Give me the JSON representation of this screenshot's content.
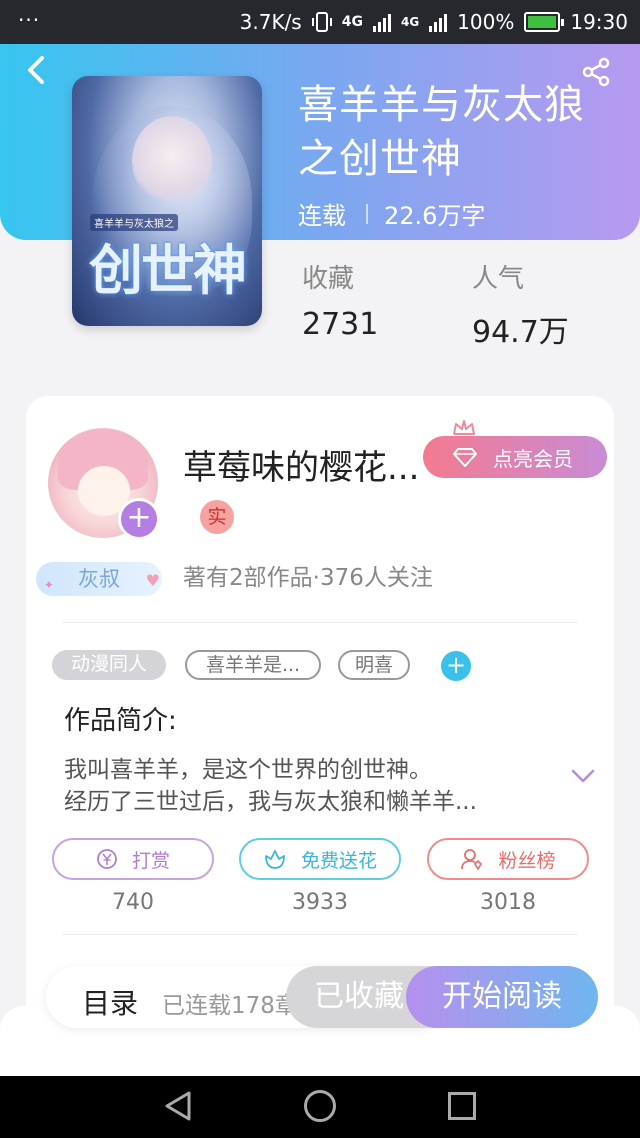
{
  "status_bar": {
    "dots": "···",
    "speed": "3.7K/s",
    "net1": "4G",
    "net2": "4G",
    "battery": "100%",
    "time": "19:30"
  },
  "book": {
    "title": "喜羊羊与灰太狼之创世神",
    "status": "连载",
    "word_count": "22.6万字",
    "cover_title_art": "创世神",
    "cover_small_text": "喜羊羊与灰太狼之",
    "stats": [
      {
        "label": "收藏",
        "value": "2731"
      },
      {
        "label": "人气",
        "value": "94.7万"
      }
    ]
  },
  "author": {
    "name": "草莓味的樱花...",
    "badge": "实",
    "meta": "著有2部作品·376人关注",
    "level_tag": "灰叔",
    "member_button": "点亮会员"
  },
  "tags": [
    {
      "label": "动漫同人",
      "style": "filled"
    },
    {
      "label": "喜羊羊是...",
      "style": "outline"
    },
    {
      "label": "明喜",
      "style": "outline"
    }
  ],
  "intro": {
    "title": "作品简介:",
    "text_line1": "我叫喜羊羊，是这个世界的创世神。",
    "text_line2": "经历了三世过后，我与灰太狼和懒羊羊..."
  },
  "actions": [
    {
      "label": "打赏",
      "count": "740",
      "icon": "yen-circle-icon"
    },
    {
      "label": "免费送花",
      "count": "3933",
      "icon": "flower-icon"
    },
    {
      "label": "粉丝榜",
      "count": "3018",
      "icon": "user-rank-icon"
    }
  ],
  "bottom": {
    "toc_label": "目录",
    "toc_status": "已连载178章",
    "collected": "已收藏",
    "read": "开始阅读"
  },
  "colors": {
    "header_gradient_start": "#36c6ef",
    "header_gradient_end": "#b79af0",
    "accent_purple": "#b57ee3",
    "accent_blue": "#39c1ec",
    "accent_red": "#ee6b6b"
  }
}
